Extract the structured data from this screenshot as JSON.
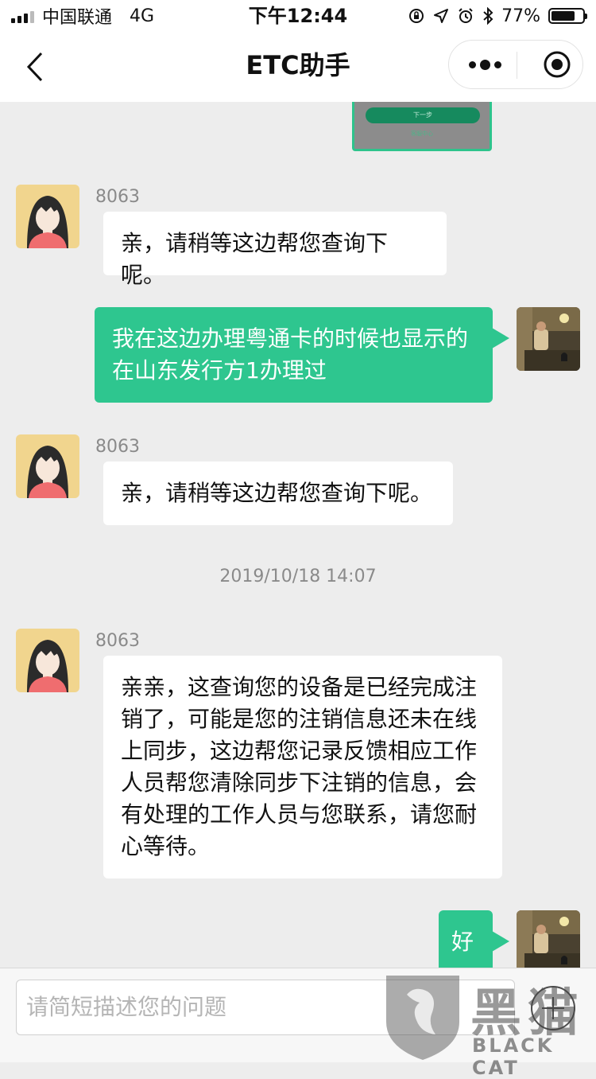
{
  "status_bar": {
    "carrier": "中国联通",
    "network": "4G",
    "time": "下午12:44",
    "battery": "77%",
    "battery_level": 0.77
  },
  "nav": {
    "title": "ETC助手"
  },
  "chat": {
    "image_message": {
      "button_text": "下一步",
      "link_text": "客服中心"
    },
    "messages": [
      {
        "direction": "in",
        "sender": "8063",
        "text": "亲，请稍等这边帮您查询下呢。"
      },
      {
        "direction": "out",
        "text": "我在这边办理粤通卡的时候也显示的在山东发行方1办理过"
      },
      {
        "direction": "in",
        "sender": "8063",
        "text": "亲，请稍等这边帮您查询下呢。"
      },
      {
        "direction": "in",
        "sender": "8063",
        "text": "亲亲，这查询您的设备是已经完成注销了，可能是您的注销信息还未在线上同步，这边帮您记录反馈相应工作人员帮您清除同步下注销的信息，会有处理的工作人员与您联系，请您耐心等待。"
      },
      {
        "direction": "out",
        "text": "好"
      }
    ],
    "timestamp": "2019/10/18 14:07"
  },
  "input": {
    "placeholder": "请简短描述您的问题"
  },
  "watermark": {
    "brand": "黑猫",
    "brand_en": "BLACK CAT"
  },
  "colors": {
    "accent": "#2ec68f",
    "background": "#ededed"
  }
}
